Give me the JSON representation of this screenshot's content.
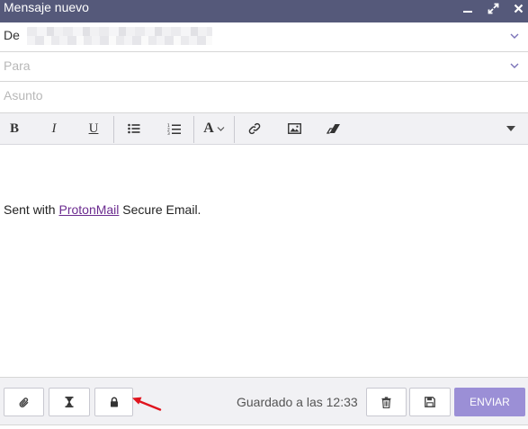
{
  "window": {
    "title": "Mensaje nuevo",
    "controls": [
      "minimize-icon",
      "expand-icon",
      "close-icon"
    ]
  },
  "fields": {
    "from_label": "De",
    "to_placeholder": "Para",
    "subject_placeholder": "Asunto"
  },
  "toolbar": {
    "bold": "B",
    "italic": "I",
    "underline": "U",
    "font_size": "A",
    "icons": [
      "bold-icon",
      "italic-icon",
      "underline-icon",
      "bulleted-list-icon",
      "numbered-list-icon",
      "font-size-icon",
      "link-icon",
      "image-icon",
      "eraser-icon",
      "more-caret-icon"
    ]
  },
  "editor": {
    "signature_prefix": "Sent with ",
    "signature_link": "ProtonMail",
    "signature_suffix": " Secure Email."
  },
  "footer": {
    "saved_status": "Guardado a las 12:33",
    "send_label": "ENVIAR",
    "icons": [
      "paperclip-icon",
      "hourglass-icon",
      "lock-icon",
      "trash-icon",
      "save-icon"
    ]
  },
  "colors": {
    "titlebar": "#55597a",
    "send_button": "#9b8fd6",
    "link": "#6b2b8f",
    "annotation_arrow": "#e0141e"
  }
}
